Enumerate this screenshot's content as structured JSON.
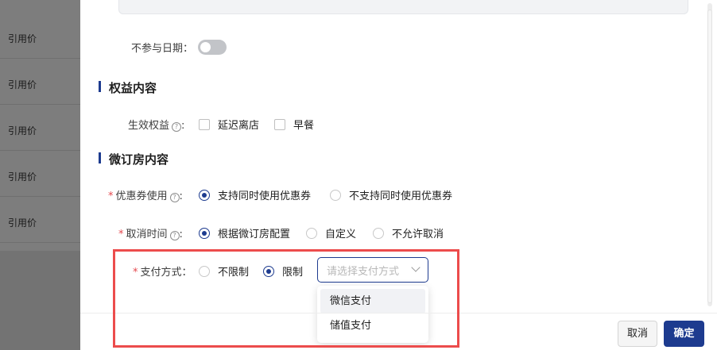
{
  "background": {
    "rows": [
      "引用价",
      "引用价",
      "引用价",
      "引用价",
      "引用价"
    ]
  },
  "form": {
    "no_date_label": "不参与日期：",
    "no_date_enabled": false,
    "section_rights": "权益内容",
    "rights": {
      "label": "生效权益",
      "options": [
        "延迟离店",
        "早餐"
      ]
    },
    "section_booking": "微订房内容",
    "coupon": {
      "label": "优惠券使用",
      "options": [
        "支持同时使用优惠券",
        "不支持同时使用优惠券"
      ],
      "selected": "支持同时使用优惠券"
    },
    "cancel_time": {
      "label": "取消时间",
      "options": [
        "根据微订房配置",
        "自定义",
        "不允许取消"
      ],
      "selected": "根据微订房配置"
    },
    "payment": {
      "label": "支付方式：",
      "options": [
        "不限制",
        "限制"
      ],
      "selected": "限制",
      "select_placeholder": "请选择支付方式",
      "dropdown_options": [
        "微信支付",
        "储值支付"
      ],
      "hovered": "微信支付"
    },
    "required_mark": "*",
    "help_icon_glyph": "?"
  },
  "footer": {
    "cancel_label": "取消",
    "confirm_label": "确定"
  },
  "colors": {
    "primary": "#1d3b8f",
    "highlight": "#ec4c4c",
    "required": "#e5484d"
  }
}
